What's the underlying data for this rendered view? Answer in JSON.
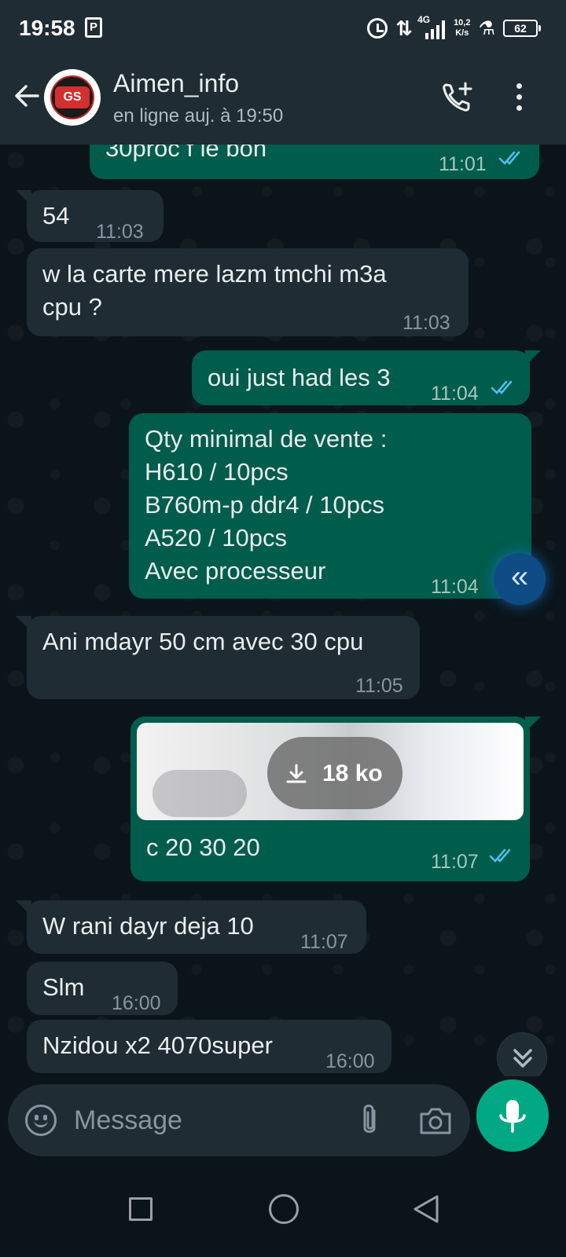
{
  "status_bar": {
    "time": "19:58",
    "network": "4G",
    "speed_value": "10,2",
    "speed_unit": "K/s",
    "battery": "62"
  },
  "header": {
    "contact_name": "Aimen_info",
    "contact_status": "en ligne auj. à 19:50",
    "avatar_text": "GS"
  },
  "messages": [
    {
      "dir": "out",
      "text": "30proc f le bon",
      "time": "11:01",
      "read": true
    },
    {
      "dir": "in",
      "text": "54",
      "time": "11:03"
    },
    {
      "dir": "in",
      "text": "w la carte mere lazm tmchi m3a\ncpu ?",
      "time": "11:03"
    },
    {
      "dir": "out",
      "text": "oui just had les 3",
      "time": "11:04",
      "read": true
    },
    {
      "dir": "out",
      "text": "Qty minimal de vente :\nH610 / 10pcs\nB760m-p ddr4 / 10pcs\nA520 / 10pcs\nAvec processeur",
      "time": "11:04"
    },
    {
      "dir": "in",
      "text": "Ani mdayr 50 cm avec 30 cpu",
      "time": "11:05"
    },
    {
      "dir": "out",
      "text": "c 20 30 20",
      "time": "11:07",
      "read": true,
      "media_size": "18 ko"
    },
    {
      "dir": "in",
      "text": "W rani dayr deja 10",
      "time": "11:07"
    },
    {
      "dir": "in",
      "text": "Slm",
      "time": "16:00"
    },
    {
      "dir": "in",
      "text": "Nzidou x2 4070super",
      "time": "16:00"
    }
  ],
  "composer": {
    "placeholder": "Message"
  },
  "colors": {
    "incoming_bubble": "#1f2c34",
    "outgoing_bubble": "#005c4b",
    "accent": "#00a884",
    "read_ticks": "#53bdeb"
  }
}
